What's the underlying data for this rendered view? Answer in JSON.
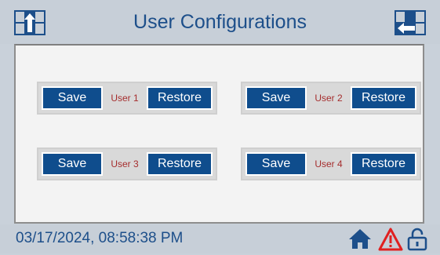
{
  "header": {
    "title": "User Configurations",
    "left_nav_icon": "screen-nav-left-icon",
    "right_nav_icon": "screen-nav-right-icon"
  },
  "users": [
    {
      "save_label": "Save",
      "user_label": "User 1",
      "restore_label": "Restore"
    },
    {
      "save_label": "Save",
      "user_label": "User 2",
      "restore_label": "Restore"
    },
    {
      "save_label": "Save",
      "user_label": "User 3",
      "restore_label": "Restore"
    },
    {
      "save_label": "Save",
      "user_label": "User 4",
      "restore_label": "Restore"
    }
  ],
  "status_bar": {
    "datetime": "03/17/2024, 08:58:38 PM",
    "icons": [
      "home-icon",
      "warning-icon",
      "lock-open-icon"
    ]
  },
  "colors": {
    "accent": "#0f4d8d",
    "title_text": "#1d4f8a",
    "user_label": "#a52d2d",
    "warning": "#e02020"
  }
}
